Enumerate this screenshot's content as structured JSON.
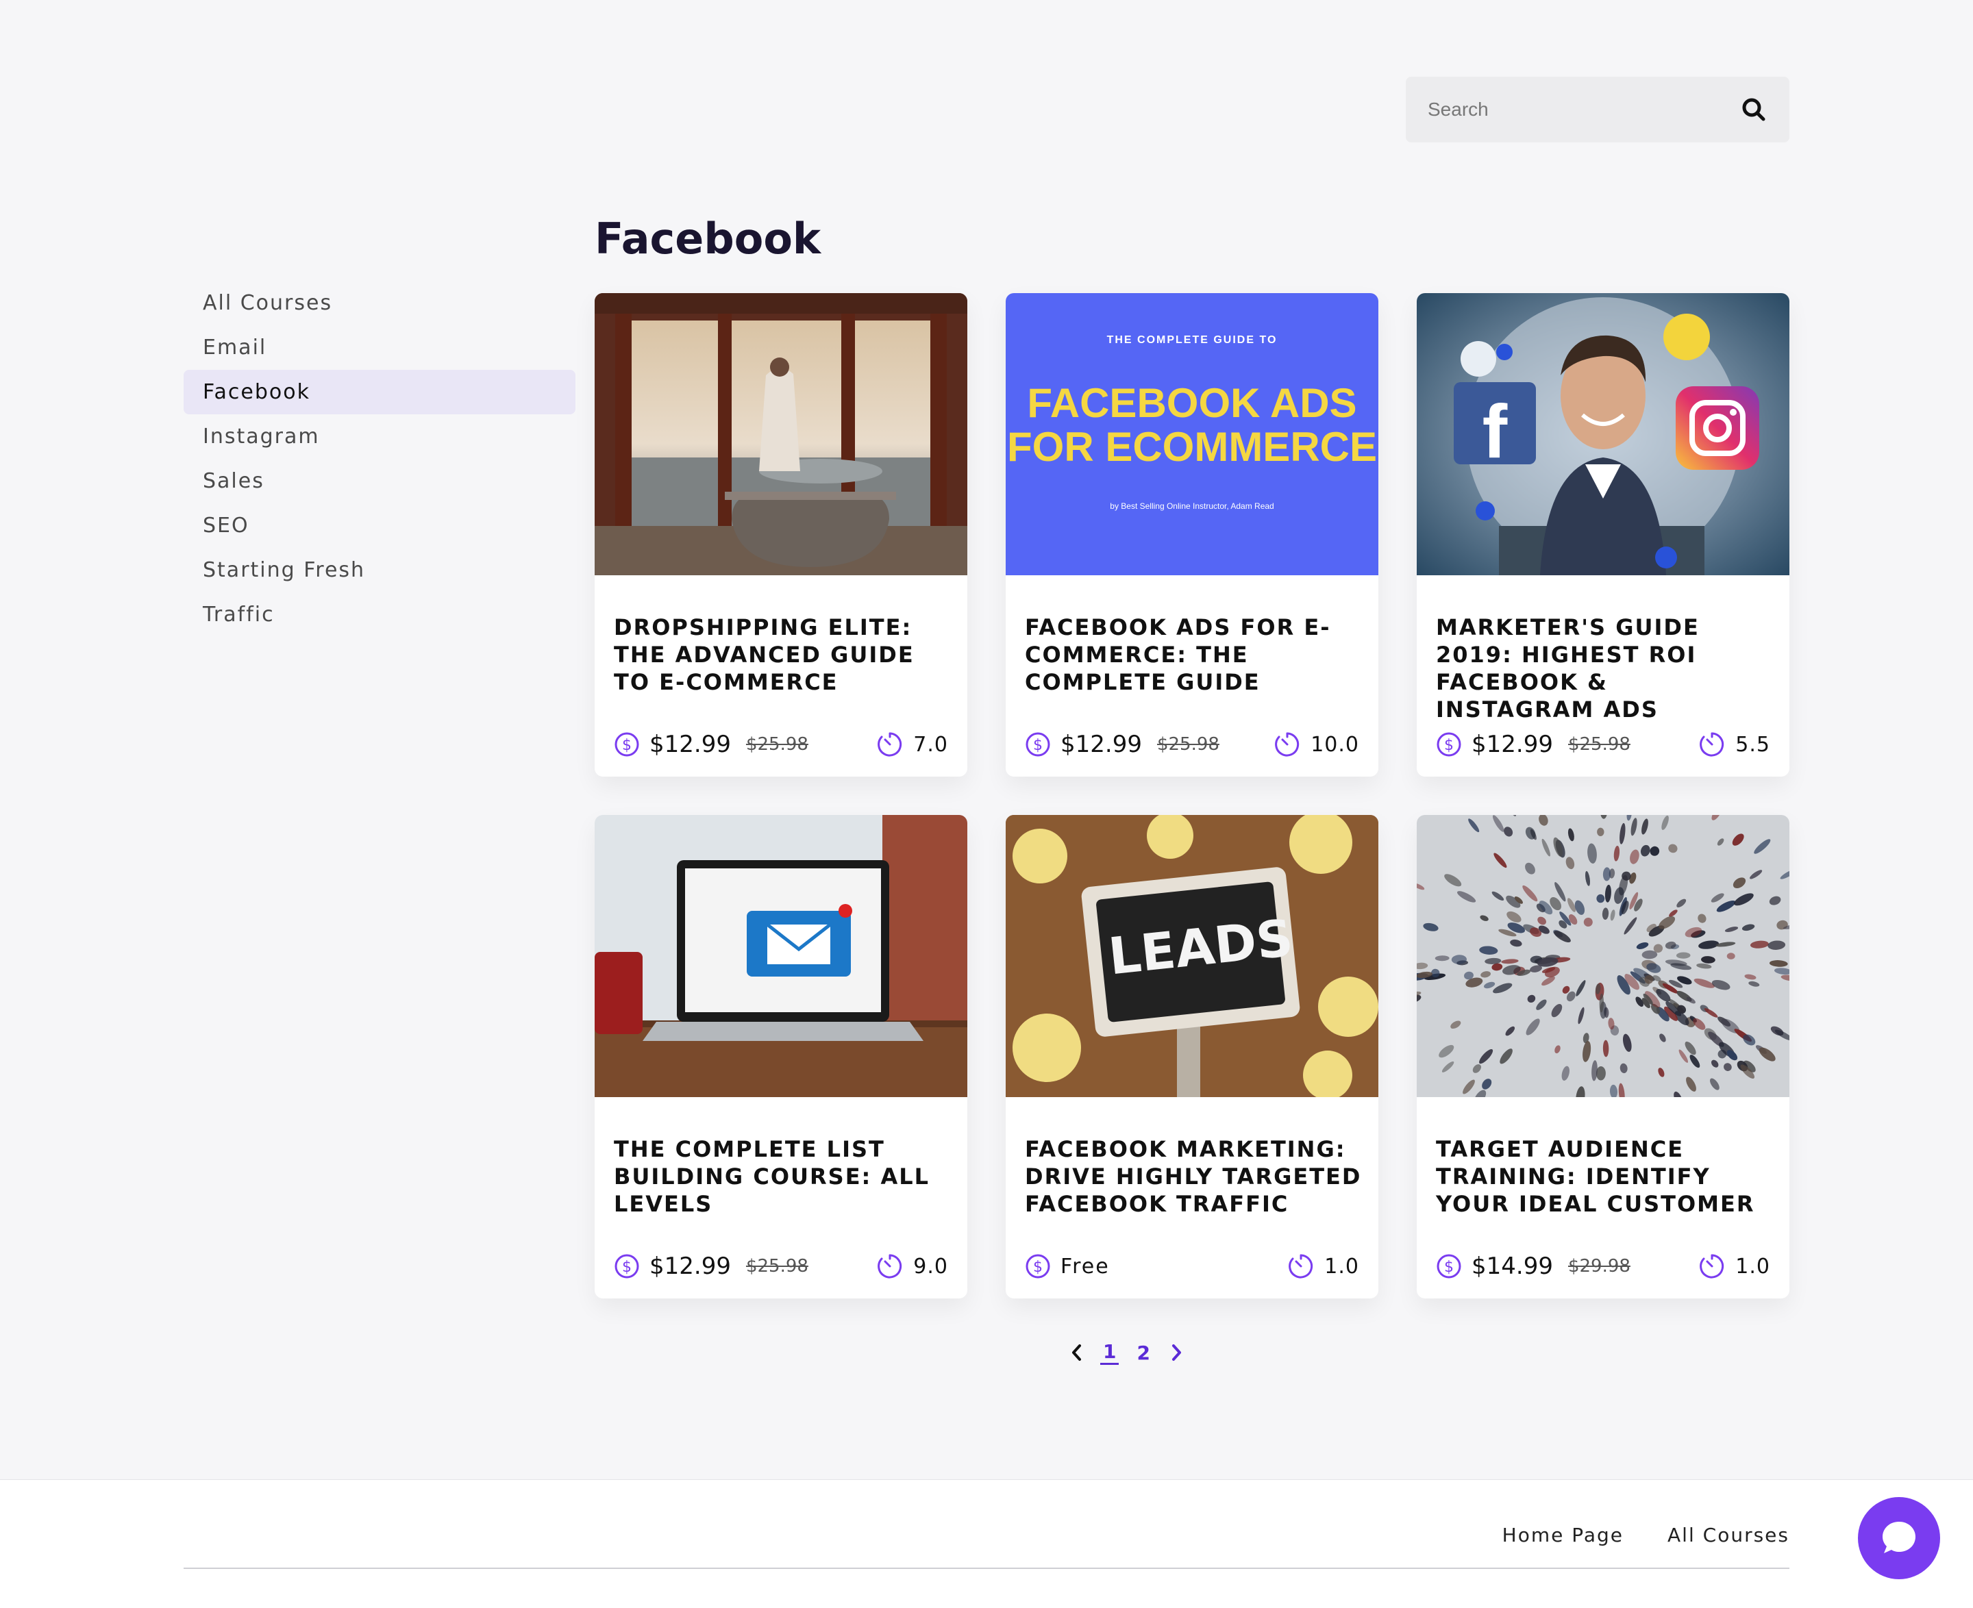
{
  "search": {
    "placeholder": "Search"
  },
  "sidebar": {
    "items": [
      {
        "label": "All Courses"
      },
      {
        "label": "Email"
      },
      {
        "label": "Facebook",
        "active": true
      },
      {
        "label": "Instagram"
      },
      {
        "label": "Sales"
      },
      {
        "label": "SEO"
      },
      {
        "label": "Starting Fresh"
      },
      {
        "label": "Traffic"
      }
    ]
  },
  "main": {
    "heading": "Facebook",
    "courses": [
      {
        "title": "DROPSHIPPING ELITE: THE ADVANCED GUIDE TO E-COMMERCE",
        "price": "$12.99",
        "old_price": "$25.98",
        "hours": "7.0",
        "image": "man-in-robe-by-window-photo"
      },
      {
        "title": "FACEBOOK ADS FOR E-COMMERCE: THE COMPLETE GUIDE",
        "price": "$12.99",
        "old_price": "$25.98",
        "hours": "10.0",
        "image": "facebook-ads-cover",
        "cover": {
          "kicker": "THE COMPLETE GUIDE TO",
          "line1": "FACEBOOK ADS",
          "line2": "FOR ECOMMERCE",
          "byline": "by Best Selling Online Instructor, Adam Read"
        }
      },
      {
        "title": "MARKETER'S GUIDE 2019: HIGHEST ROI FACEBOOK & INSTAGRAM ADS",
        "price": "$12.99",
        "old_price": "$25.98",
        "hours": "5.5",
        "image": "instructor-social-icons-photo"
      },
      {
        "title": "THE COMPLETE LIST BUILDING COURSE: ALL LEVELS",
        "price": "$12.99",
        "old_price": "$25.98",
        "hours": "9.0",
        "image": "laptop-email-photo"
      },
      {
        "title": "FACEBOOK MARKETING: DRIVE HIGHLY TARGETED FACEBOOK TRAFFIC",
        "price": "Free",
        "old_price": "",
        "hours": "1.0",
        "image": "leads-sign-photo",
        "sign_text": "LEADS"
      },
      {
        "title": "TARGET AUDIENCE TRAINING: IDENTIFY YOUR IDEAL CUSTOMER",
        "price": "$14.99",
        "old_price": "$29.98",
        "hours": "1.0",
        "image": "crowd-aerial-photo"
      }
    ]
  },
  "pagination": {
    "pages": [
      "1",
      "2"
    ],
    "current": "1"
  },
  "footer": {
    "links": [
      {
        "label": "Home Page"
      },
      {
        "label": "All Courses"
      }
    ]
  },
  "colors": {
    "accent": "#7a3cf0",
    "active_bg": "#e9e6f6",
    "cover_blue": "#5566f5",
    "cover_yellow": "#f5d742"
  }
}
